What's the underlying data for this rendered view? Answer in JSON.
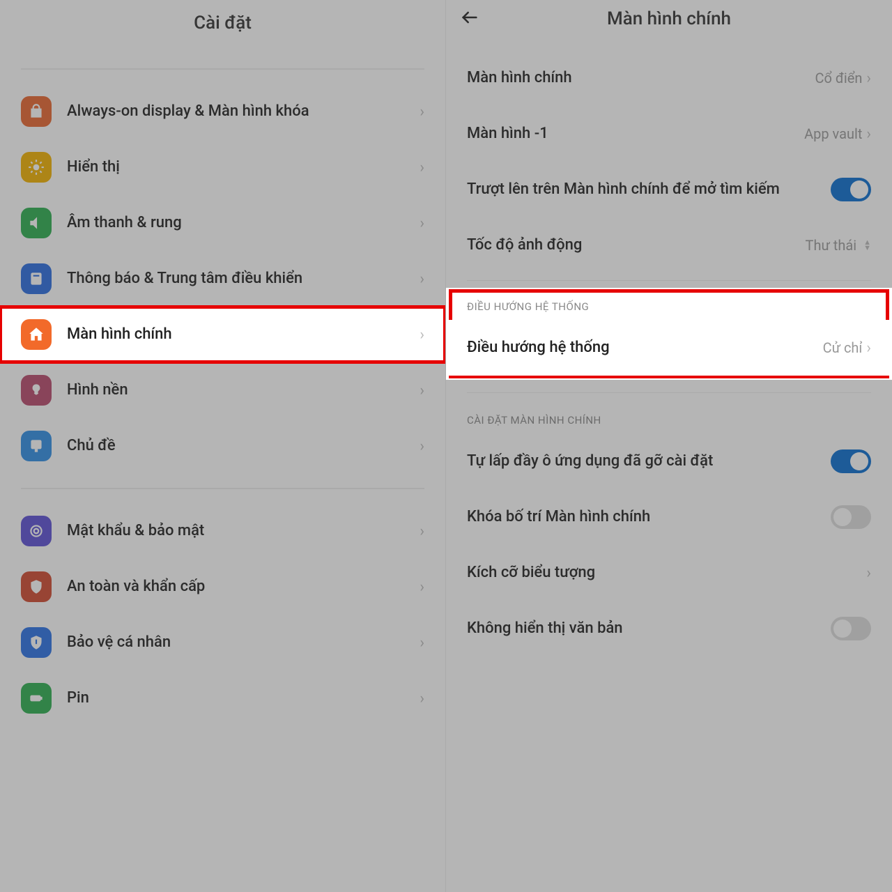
{
  "left": {
    "title": "Cài đặt",
    "rows": [
      {
        "label": "Always-on display & Màn hình khóa",
        "icon": "lock-icon",
        "bg": "#e8672f"
      },
      {
        "label": "Hiển thị",
        "icon": "sun-icon",
        "bg": "#f2b200"
      },
      {
        "label": "Âm thanh & rung",
        "icon": "sound-icon",
        "bg": "#2cae4f"
      },
      {
        "label": "Thông báo & Trung tâm điều khiển",
        "icon": "notif-icon",
        "bg": "#2a6de0"
      },
      {
        "label": "Màn hình chính",
        "icon": "home-icon",
        "bg": "#f26a2a",
        "highlight": true
      },
      {
        "label": "Hình nền",
        "icon": "wallpaper-icon",
        "bg": "#b94a6c"
      },
      {
        "label": "Chủ đề",
        "icon": "theme-icon",
        "bg": "#2f8fe6"
      }
    ],
    "divider": true,
    "rows2": [
      {
        "label": "Mật khẩu & bảo mật",
        "icon": "security-icon",
        "bg": "#5d4fd6"
      },
      {
        "label": "An toàn và khẩn cấp",
        "icon": "emergency-icon",
        "bg": "#d14a2f"
      },
      {
        "label": "Bảo vệ cá nhân",
        "icon": "privacy-icon",
        "bg": "#2a72e6"
      },
      {
        "label": "Pin",
        "icon": "battery-icon",
        "bg": "#2cae4f"
      }
    ]
  },
  "right": {
    "title": "Màn hình chính",
    "group1": [
      {
        "label": "Màn hình chính",
        "value": "Cổ điển",
        "type": "chev"
      },
      {
        "label": "Màn hình -1",
        "value": "App vault",
        "type": "chev"
      },
      {
        "label": "Trượt lên trên Màn hình chính để mở tìm kiếm",
        "type": "toggle",
        "on": true
      },
      {
        "label": "Tốc độ ảnh động",
        "value": "Thư thái",
        "type": "select"
      }
    ],
    "section_nav_header": "ĐIỀU HƯỚNG HỆ THỐNG",
    "nav_row": {
      "label": "Điều hướng hệ thống",
      "value": "Cử chỉ",
      "type": "chev"
    },
    "section_home_header": "CÀI ĐẶT MÀN HÌNH CHÍNH",
    "group3": [
      {
        "label": "Tự lấp đầy ô ứng dụng đã gỡ cài đặt",
        "type": "toggle",
        "on": true
      },
      {
        "label": "Khóa bố trí Màn hình chính",
        "type": "toggle",
        "on": false
      },
      {
        "label": "Kích cỡ biểu tượng",
        "type": "chev"
      },
      {
        "label": "Không hiển thị văn bản",
        "type": "toggle",
        "on": false
      }
    ]
  }
}
